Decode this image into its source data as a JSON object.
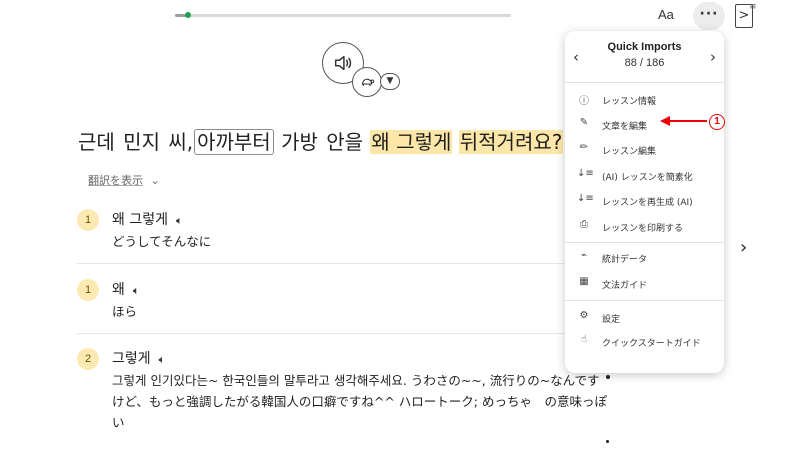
{
  "toolbar": {
    "progress_percent": 4,
    "font_button_label": "Aa",
    "more_button_label": "···",
    "panel_toggle_label": ">"
  },
  "audio": {
    "speaker_icon": "speaker-icon",
    "speed_icon": "turtle-icon",
    "chevron_icon": "chevron-down-icon"
  },
  "sentence": {
    "words": [
      "근데",
      "민지",
      "씨,",
      "아까부터",
      "가방",
      "안을",
      "왜 그렇게",
      "뒤적거려요?"
    ]
  },
  "translation_toggle": {
    "label": "翻訳を表示",
    "chevron": "⌄"
  },
  "vocab": [
    {
      "badge": "1",
      "term": "왜 그렇게",
      "definition": "どうしてそんなに"
    },
    {
      "badge": "1",
      "term": "왜",
      "definition": "ほら"
    },
    {
      "badge": "2",
      "term": "그렇게",
      "definition": "그렇게 인기있다는~ 한국인들의 말투라고 생각해주세요. うわさの~~, 流行りの~なんですけど、もっと強調したがる韓国人の口癖ですね^^ ハロートーク; めっちゃ　の意味っぽい"
    }
  ],
  "next_arrow": "›",
  "menu": {
    "title": "Quick Imports",
    "count": "88 / 186",
    "prev": "‹",
    "next": "›",
    "items": [
      {
        "icon": "ⓘ",
        "icon_name": "info-icon",
        "label": "レッスン情報"
      },
      {
        "icon": "✎",
        "icon_name": "pencil-icon",
        "label": "文章を編集"
      },
      {
        "icon": "✏",
        "icon_name": "pencil-alt-icon",
        "label": "レッスン編集"
      },
      {
        "icon": "↓≡",
        "icon_name": "sort-icon",
        "label": "(AI) レッスンを簡素化"
      },
      {
        "icon": "↓≡",
        "icon_name": "sort-icon",
        "label": "レッスンを再生成 (AI)"
      },
      {
        "icon": "⎙",
        "icon_name": "printer-icon",
        "label": "レッスンを印刷する"
      },
      {
        "icon": "⌁",
        "icon_name": "chart-icon",
        "label": "統計データ"
      },
      {
        "icon": "▦",
        "icon_name": "grammar-book-icon",
        "label": "文法ガイド"
      },
      {
        "icon": "⚙",
        "icon_name": "gear-icon",
        "label": "設定"
      },
      {
        "icon": "☝",
        "icon_name": "hand-icon",
        "label": "クイックスタートガイド"
      }
    ]
  },
  "annotation": {
    "number": "1",
    "color": "#e00000"
  }
}
